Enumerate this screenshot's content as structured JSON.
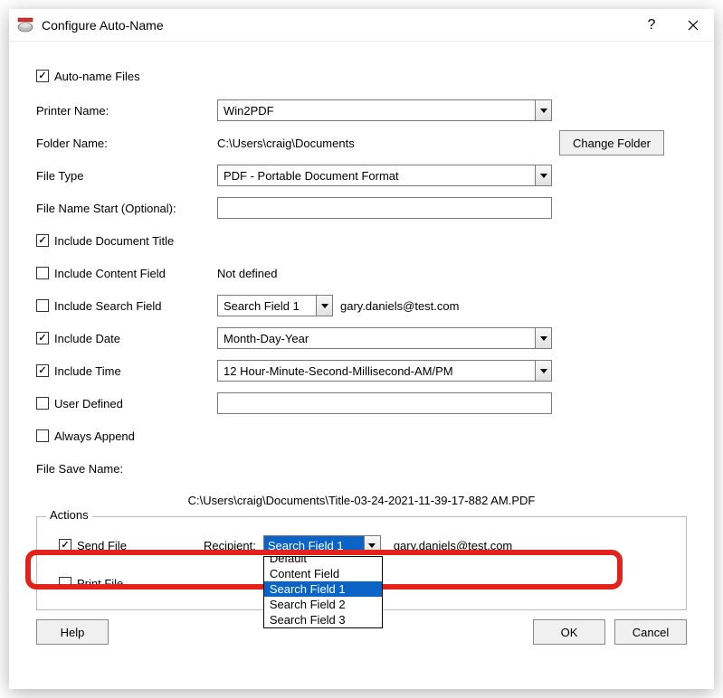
{
  "title": "Configure Auto-Name",
  "autoName": {
    "label": "Auto-name Files",
    "checked": true
  },
  "printerName": {
    "label": "Printer Name:",
    "value": "Win2PDF"
  },
  "folderName": {
    "label": "Folder Name:",
    "value": "C:\\Users\\craig\\Documents",
    "changeBtn": "Change Folder"
  },
  "fileType": {
    "label": "File Type",
    "value": "PDF - Portable Document Format"
  },
  "fileNameStart": {
    "label": "File Name Start (Optional):",
    "value": ""
  },
  "includeDocTitle": {
    "label": "Include Document Title",
    "checked": true
  },
  "includeContentField": {
    "label": "Include Content Field",
    "checked": false,
    "value": "Not defined"
  },
  "includeSearchField": {
    "label": "Include Search Field",
    "checked": false,
    "value": "Search Field 1",
    "resolved": "gary.daniels@test.com"
  },
  "includeDate": {
    "label": "Include Date",
    "checked": true,
    "value": "Month-Day-Year"
  },
  "includeTime": {
    "label": "Include Time",
    "checked": true,
    "value": "12 Hour-Minute-Second-Millisecond-AM/PM"
  },
  "userDefined": {
    "label": "User Defined",
    "checked": false,
    "value": ""
  },
  "alwaysAppend": {
    "label": "Always Append",
    "checked": false
  },
  "fileSaveName": {
    "label": "File Save Name:",
    "value": "C:\\Users\\craig\\Documents\\Title-03-24-2021-11-39-17-882 AM.PDF"
  },
  "actions": {
    "legend": "Actions",
    "sendFile": {
      "label": "Send File",
      "checked": true
    },
    "recipientLabel": "Recipient:",
    "recipientSelected": "Search Field 1",
    "recipientResolved": "gary.daniels@test.com",
    "recipientOptions": [
      "Default",
      "Content Field",
      "Search Field 1",
      "Search Field 2",
      "Search Field 3"
    ],
    "printFile": {
      "label": "Print File",
      "checked": false
    }
  },
  "buttons": {
    "help": "Help",
    "ok": "OK",
    "cancel": "Cancel"
  }
}
